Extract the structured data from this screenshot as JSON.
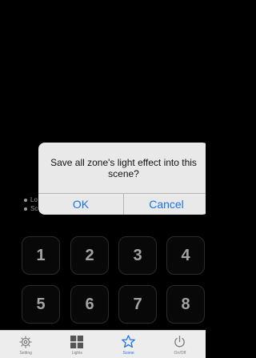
{
  "legend": {
    "items": [
      {
        "label": "Lo"
      },
      {
        "label": "Sc"
      }
    ]
  },
  "keypad": {
    "keys": [
      "1",
      "2",
      "3",
      "4",
      "5",
      "6",
      "7",
      "8"
    ]
  },
  "dialog": {
    "message": "Save all zone's light effect into this scene?",
    "ok_label": "OK",
    "cancel_label": "Cancel"
  },
  "tabbar": {
    "tabs": [
      {
        "label": "Setting",
        "icon": "gear-icon"
      },
      {
        "label": "Lights",
        "icon": "grid-icon"
      },
      {
        "label": "Scene",
        "icon": "star-icon",
        "active": true
      },
      {
        "label": "On/Off",
        "icon": "power-icon"
      }
    ]
  },
  "colors": {
    "accent": "#1a73e8",
    "background": "#000000",
    "tabbar": "#ededed"
  }
}
